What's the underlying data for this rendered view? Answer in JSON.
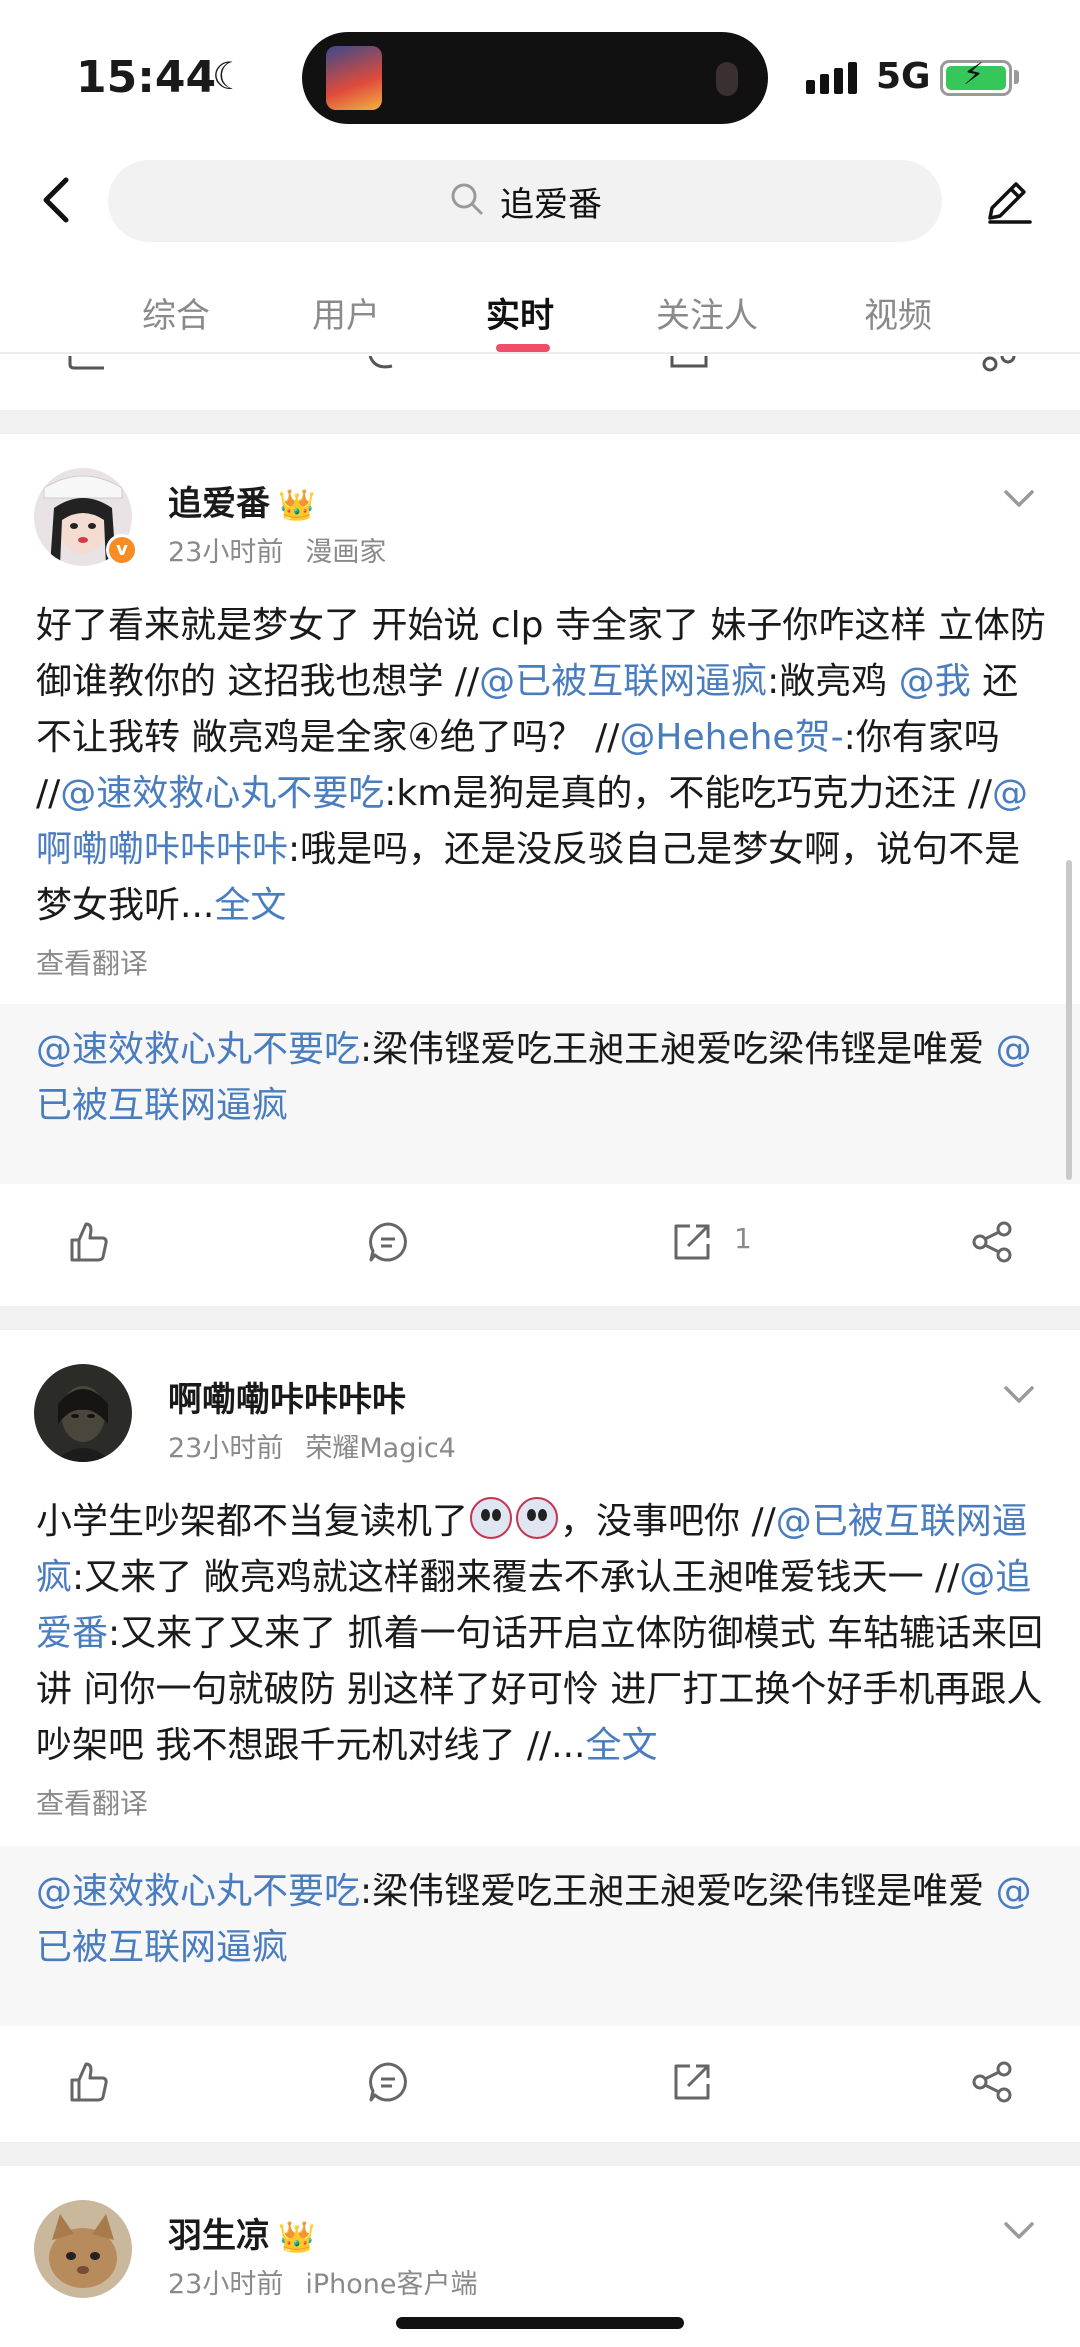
{
  "status_bar": {
    "time": "15:44",
    "network": "5G"
  },
  "search": {
    "query": "追爱番"
  },
  "tabs": [
    {
      "label": "综合"
    },
    {
      "label": "用户"
    },
    {
      "label": "实时",
      "active": true
    },
    {
      "label": "关注人"
    },
    {
      "label": "视频"
    }
  ],
  "posts": [
    {
      "author": "追爱番",
      "meta": {
        "time": "23小时前",
        "source": "漫画家"
      },
      "body": {
        "t1": "好了看来就是梦女了 开始说 clp 寺全家了 妹子你咋这样 立体防御谁教你的 这招我也想学 //",
        "m1": "@已被互联网逼疯",
        "t2": ":敞亮鸡 ",
        "m2": "@我",
        "t3": " 还不让我转 敞亮鸡是全家④绝了吗？ //",
        "m3": "@Hehehe贺-",
        "t4": ":你有家吗 //",
        "m4": "@速效救心丸不要吃",
        "t5": ":km是狗是真的，不能吃巧克力还汪 //",
        "m5": "@啊嘞嘞咔咔咔咔",
        "t6": ":哦是吗，还是没反驳自己是梦女啊，说句不是梦女我听...",
        "more": "全文"
      },
      "translate": "查看翻译",
      "quote": {
        "m1": "@速效救心丸不要吃",
        "text": ":梁伟铿爱吃王昶王昶爱吃梁伟铿是唯爱 ",
        "m2": "@已被互联网逼疯"
      },
      "repost_count": "1"
    },
    {
      "author": "啊嘞嘞咔咔咔咔",
      "meta": {
        "time": "23小时前",
        "source": "荣耀Magic4"
      },
      "body": {
        "t1": "小学生吵架都不当复读机了",
        "t2": "，没事吧你 //",
        "m1": "@已被互联网逼疯",
        "t3": ":又来了 敞亮鸡就这样翻来覆去不承认王昶唯爱钱天一 //",
        "m2": "@追爱番",
        "t4": ":又来了又来了 抓着一句话开启立体防御模式 车轱辘话来回讲 问你一句就破防 别这样了好可怜 进厂打工换个好手机再跟人吵架吧 我不想跟千元机对线了 //...",
        "more": "全文"
      },
      "translate": "查看翻译",
      "quote": {
        "m1": "@速效救心丸不要吃",
        "text": ":梁伟铿爱吃王昶王昶爱吃梁伟铿是唯爱 ",
        "m2": "@已被互联网逼疯"
      }
    },
    {
      "author": "羽生凉",
      "meta": {
        "time": "23小时前",
        "source": "iPhone客户端"
      }
    }
  ],
  "colors": {
    "link": "#4a7cc0",
    "tab_indicator": "#f24d68",
    "separator": "#f2f2f2"
  },
  "icons": [
    "back-arrow-icon",
    "search-icon",
    "edit-icon",
    "chevron-down-icon",
    "like-icon",
    "comment-icon",
    "repost-icon",
    "share-icon",
    "crown-icon"
  ]
}
